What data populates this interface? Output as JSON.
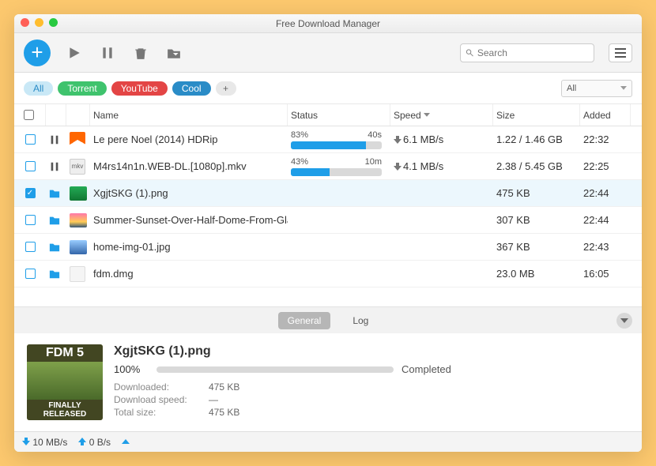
{
  "window": {
    "title": "Free Download Manager"
  },
  "toolbar": {
    "search_placeholder": "Search"
  },
  "filters": {
    "all": "All",
    "torrent": "Torrent",
    "youtube": "YouTube",
    "cool": "Cool",
    "plus": "+",
    "dropdown": "All"
  },
  "columns": {
    "name": "Name",
    "status": "Status",
    "speed": "Speed",
    "size": "Size",
    "added": "Added"
  },
  "rows": [
    {
      "name": "Le pere Noel (2014) HDRip",
      "percent": "83%",
      "eta": "40s",
      "bar": 83,
      "speed": "6.1 MB/s",
      "size": "1.22 / 1.46 GB",
      "added": "22:32",
      "checked": false,
      "state": "pause",
      "thumb": "vlc"
    },
    {
      "name": "M4rs14n1n.WEB-DL.[1080p].mkv",
      "percent": "43%",
      "eta": "10m",
      "bar": 43,
      "speed": "4.1 MB/s",
      "size": "2.38 / 5.45 GB",
      "added": "22:25",
      "checked": false,
      "state": "pause",
      "thumb": "mkv"
    },
    {
      "name": "XgjtSKG (1).png",
      "percent": "",
      "eta": "",
      "bar": 0,
      "speed": "",
      "size": "475 KB",
      "added": "22:44",
      "checked": true,
      "state": "folder",
      "thumb": "fdm",
      "selected": true
    },
    {
      "name": "Summer-Sunset-Over-Half-Dome-From-Glacier-Point-Yosemite-National-Park…",
      "percent": "",
      "eta": "",
      "bar": 0,
      "speed": "",
      "size": "307 KB",
      "added": "22:44",
      "checked": false,
      "state": "folder",
      "thumb": "sunset"
    },
    {
      "name": "home-img-01.jpg",
      "percent": "",
      "eta": "",
      "bar": 0,
      "speed": "",
      "size": "367 KB",
      "added": "22:43",
      "checked": false,
      "state": "folder",
      "thumb": "mountain"
    },
    {
      "name": "fdm.dmg",
      "percent": "",
      "eta": "",
      "bar": 0,
      "speed": "",
      "size": "23.0 MB",
      "added": "16:05",
      "checked": false,
      "state": "folder",
      "thumb": "dmg"
    }
  ],
  "detail_tabs": {
    "general": "General",
    "log": "Log"
  },
  "detail": {
    "title": "XgjtSKG (1).png",
    "percent": "100%",
    "status": "Completed",
    "downloaded_k": "Downloaded:",
    "downloaded_v": "475 KB",
    "speed_k": "Download speed:",
    "speed_v": "—",
    "total_k": "Total size:",
    "total_v": "475 KB",
    "thumb_top": "FDM 5",
    "thumb_bottom": "FINALLY RELEASED"
  },
  "statusbar": {
    "down": "10 MB/s",
    "up": "0 B/s"
  }
}
